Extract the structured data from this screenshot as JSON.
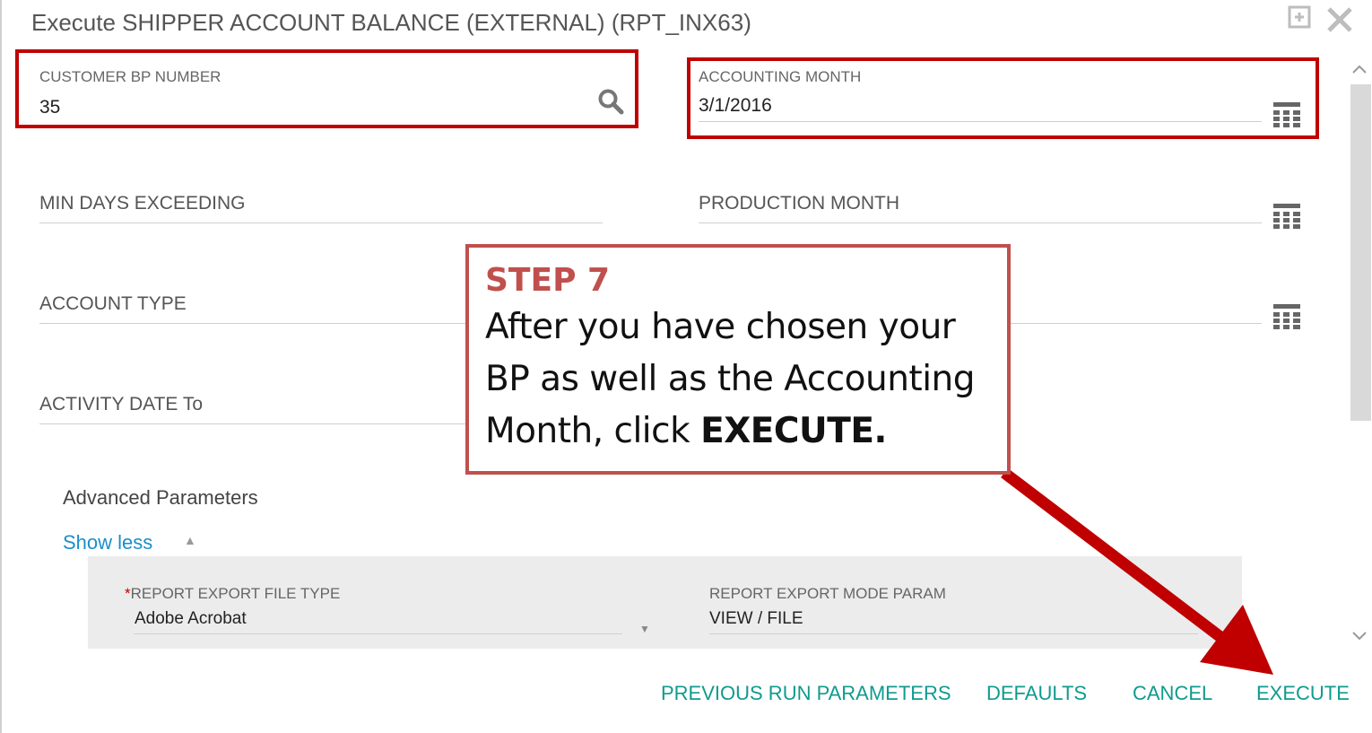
{
  "dialog": {
    "title": "Execute SHIPPER ACCOUNT BALANCE (EXTERNAL) (RPT_INX63)",
    "maximize_icon": "maximize-icon",
    "close_icon": "close-icon"
  },
  "fields": {
    "customer_bp": {
      "label": "CUSTOMER BP NUMBER",
      "value": "35",
      "icon": "search-icon"
    },
    "accounting_month": {
      "label": "ACCOUNTING MONTH",
      "value": "3/1/2016",
      "icon": "calendar-icon"
    },
    "min_days": {
      "label": "MIN DAYS EXCEEDING",
      "value": ""
    },
    "production_month": {
      "label": "PRODUCTION MONTH",
      "value": "",
      "icon": "calendar-icon"
    },
    "account_type": {
      "label": "ACCOUNT TYPE",
      "value": ""
    },
    "activity_date_from_icon": "calendar-icon",
    "activity_date_to": {
      "label": "ACTIVITY DATE To",
      "value": ""
    }
  },
  "advanced": {
    "title": "Advanced Parameters",
    "toggle_label": "Show less",
    "export_file_type": {
      "required_mark": "*",
      "label": "REPORT EXPORT FILE TYPE",
      "value": "Adobe Acrobat"
    },
    "export_mode": {
      "label": "REPORT EXPORT MODE PARAM",
      "value": "VIEW / FILE"
    }
  },
  "footer": {
    "previous": "PREVIOUS RUN PARAMETERS",
    "defaults": "DEFAULTS",
    "cancel": "CANCEL",
    "execute": "EXECUTE"
  },
  "callout": {
    "step": "STEP 7",
    "line1": "After you have chosen your",
    "line2": "BP as well as the Accounting",
    "line3_prefix": "Month, click ",
    "line3_bold": "EXECUTE."
  },
  "colors": {
    "highlight": "#c00000",
    "callout_border": "#c0504d",
    "link": "#1a8fc9",
    "footer_button": "#0f9b8e"
  }
}
